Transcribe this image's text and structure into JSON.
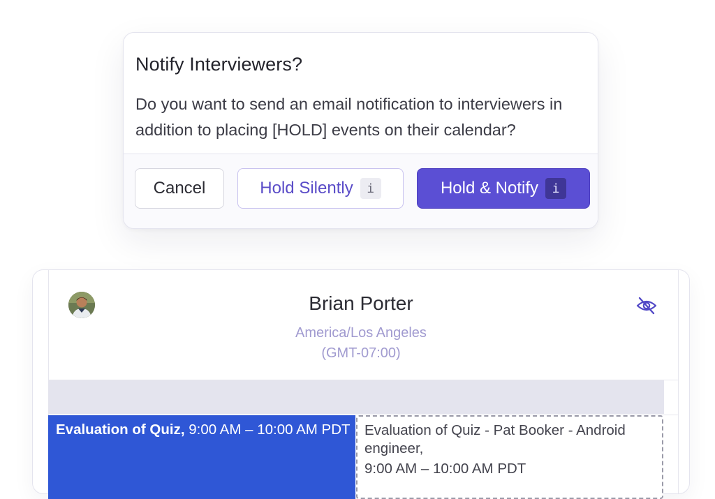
{
  "dialog": {
    "title": "Notify Interviewers?",
    "body": "Do you want to send an email notification to interviewers in addition to placing [HOLD] events on their calendar?",
    "buttons": {
      "cancel_label": "Cancel",
      "hold_silently_label": "Hold Silently",
      "hold_notify_label": "Hold & Notify",
      "info_glyph": "i"
    }
  },
  "calendar": {
    "person": {
      "name": "Brian Porter",
      "timezone": "America/Los Angeles",
      "gmt_offset": "(GMT-07:00)",
      "avatar_icon": "user-photo",
      "visibility_icon": "eye-slash-icon"
    },
    "events": [
      {
        "title": "Evaluation of Quiz,",
        "time": "9:00 AM – 10:00 AM PDT",
        "style": "solid",
        "color": "#2f57d6"
      },
      {
        "title": "Evaluation of Quiz - Pat Booker - Android engineer,",
        "time": "9:00 AM – 10:00 AM PDT",
        "style": "hold-dashed"
      }
    ]
  },
  "colors": {
    "accent": "#5b4fd4",
    "accent_text": "#5a4cc8",
    "event_blue": "#2f57d6",
    "timezone_text": "#a19bd0"
  }
}
